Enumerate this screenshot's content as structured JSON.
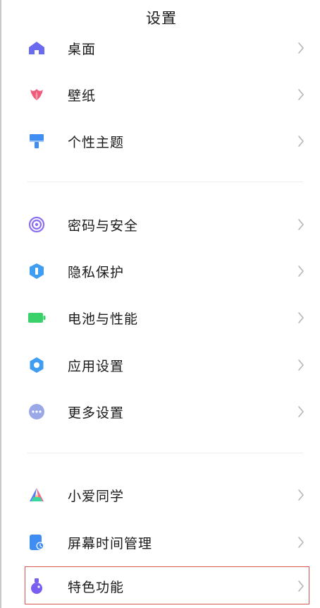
{
  "header": {
    "title": "设置"
  },
  "groups": [
    {
      "items": [
        {
          "label": "桌面",
          "icon": "home-icon"
        },
        {
          "label": "壁纸",
          "icon": "tulip-icon"
        },
        {
          "label": "个性主题",
          "icon": "brush-icon"
        }
      ]
    },
    {
      "items": [
        {
          "label": "密码与安全",
          "icon": "fingerprint-icon"
        },
        {
          "label": "隐私保护",
          "icon": "privacy-shield-icon"
        },
        {
          "label": "电池与性能",
          "icon": "battery-icon"
        },
        {
          "label": "应用设置",
          "icon": "gear-icon"
        },
        {
          "label": "更多设置",
          "icon": "more-icon"
        }
      ]
    },
    {
      "items": [
        {
          "label": "小爱同学",
          "icon": "assistant-icon"
        },
        {
          "label": "屏幕时间管理",
          "icon": "screen-time-icon"
        },
        {
          "label": "特色功能",
          "icon": "flask-icon",
          "highlighted": true
        }
      ]
    }
  ],
  "colors": {
    "home": "#6b6bf2",
    "tulip": "#ee5c7a",
    "brush": "#3f8cf2",
    "fingerprint": "#8b6ff0",
    "privacy": "#3f9df2",
    "battery": "#3ad06a",
    "gear": "#3f9df2",
    "more": "#9aa8e8",
    "flask": "#7a5ef0",
    "highlight_border": "#d9534f"
  }
}
